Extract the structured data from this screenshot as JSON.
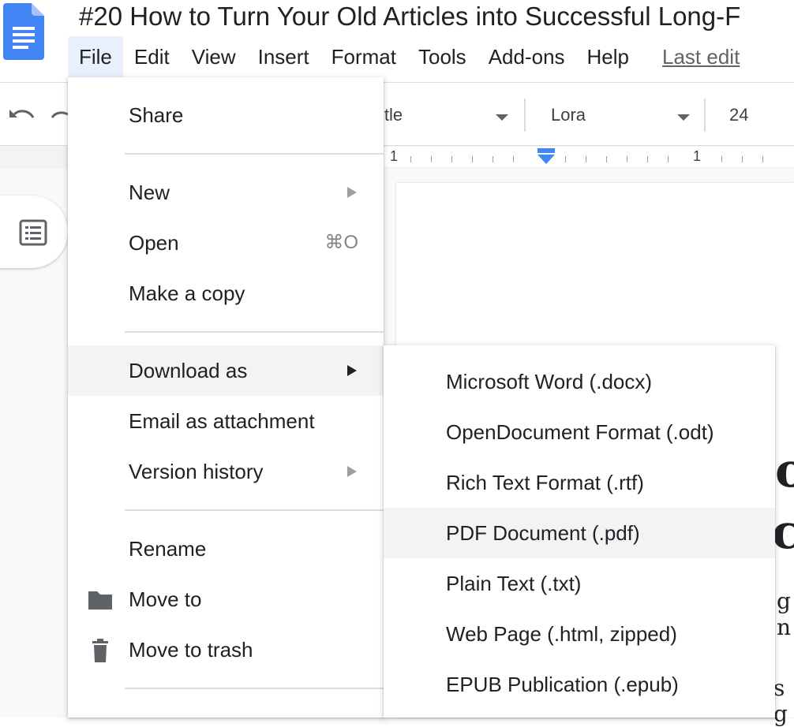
{
  "doc": {
    "title": "#20 How to Turn Your Old Articles into Successful Long-F"
  },
  "menubar": {
    "items": [
      "File",
      "Edit",
      "View",
      "Insert",
      "Format",
      "Tools",
      "Add-ons",
      "Help"
    ],
    "last_edit": "Last edit"
  },
  "toolbar": {
    "style_value": "itle",
    "font_value": "Lora",
    "size_value": "24"
  },
  "ruler": {
    "left_num": "1",
    "right_num": "1"
  },
  "file_menu": {
    "share": "Share",
    "new": "New",
    "open": "Open",
    "open_shortcut": "⌘O",
    "make_copy": "Make a copy",
    "download_as": "Download as",
    "email_attachment": "Email as attachment",
    "version_history": "Version history",
    "rename": "Rename",
    "move_to": "Move to",
    "move_to_trash": "Move to trash"
  },
  "download_submenu": {
    "items": [
      "Microsoft Word (.docx)",
      "OpenDocument Format (.odt)",
      "Rich Text Format (.rtf)",
      "PDF Document (.pdf)",
      "Plain Text (.txt)",
      "Web Page (.html, zipped)",
      "EPUB Publication (.epub)"
    ]
  },
  "page_fragments": {
    "frag1": "o",
    "frag2": "ce",
    "frag3": "g n",
    "frag4": "s g"
  },
  "colors": {
    "docs_blue": "#4285f4",
    "hover_grey": "#f1f3f4",
    "active_menu": "#e8f0fe"
  }
}
